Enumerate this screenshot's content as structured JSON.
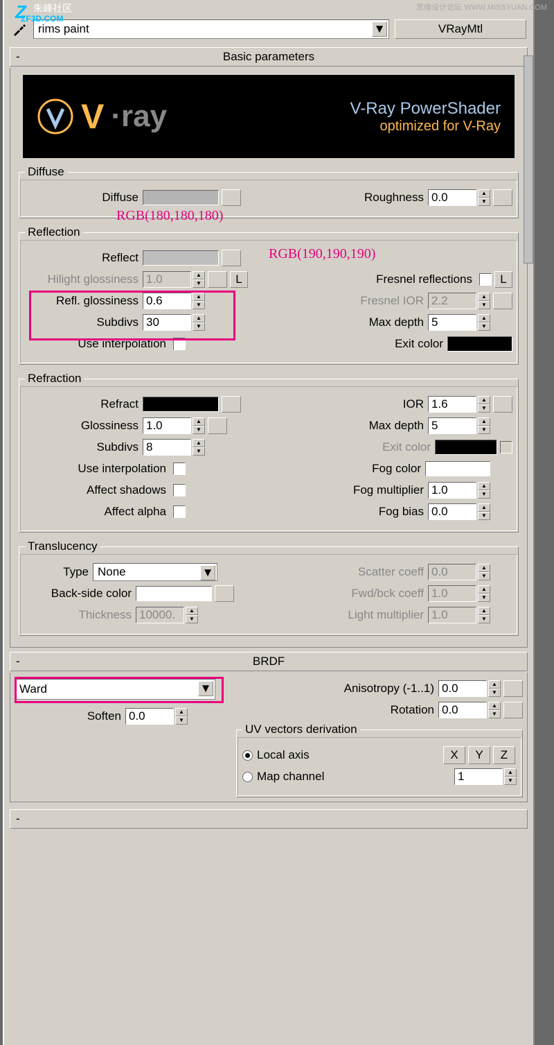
{
  "watermarks": {
    "cn": "朱峰社区",
    "zf": "ZF3D.COM",
    "z": "Z",
    "right": "思缘设计论坛 WWW.MISSYUAN.COM"
  },
  "header": {
    "material_name": "rims paint",
    "type_button": "VRayMtl"
  },
  "rollouts": {
    "basic": "Basic parameters",
    "brdf": "BRDF",
    "minus": "-"
  },
  "banner": {
    "logo_v": "V",
    "logo_text": "·ray",
    "line1": "V-Ray PowerShader",
    "line2": "optimized for V-Ray"
  },
  "groups": {
    "diffuse": "Diffuse",
    "reflection": "Reflection",
    "refraction": "Refraction",
    "translucency": "Translucency",
    "uv": "UV vectors derivation"
  },
  "labels": {
    "diffuse": "Diffuse",
    "roughness": "Roughness",
    "reflect": "Reflect",
    "hilight_gloss": "Hilight glossiness",
    "refl_gloss": "Refl. glossiness",
    "subdivs": "Subdivs",
    "use_interp": "Use interpolation",
    "fresnel_refl": "Fresnel reflections",
    "fresnel_ior": "Fresnel IOR",
    "max_depth": "Max depth",
    "exit_color": "Exit color",
    "refract": "Refract",
    "glossiness": "Glossiness",
    "ior": "IOR",
    "affect_shadows": "Affect shadows",
    "affect_alpha": "Affect alpha",
    "fog_color": "Fog color",
    "fog_mult": "Fog multiplier",
    "fog_bias": "Fog bias",
    "type": "Type",
    "back_side": "Back-side color",
    "thickness": "Thickness",
    "scatter": "Scatter coeff",
    "fwd_bck": "Fwd/bck coeff",
    "light_mult": "Light multiplier",
    "soften": "Soften",
    "anisotropy": "Anisotropy (-1..1)",
    "rotation": "Rotation",
    "local_axis": "Local axis",
    "map_channel": "Map channel",
    "L": "L",
    "X": "X",
    "Y": "Y",
    "Z": "Z"
  },
  "values": {
    "roughness": "0.0",
    "hilight_gloss": "1.0",
    "refl_gloss": "0.6",
    "refl_subdivs": "30",
    "fresnel_ior": "2.2",
    "refl_max_depth": "5",
    "refr_gloss": "1.0",
    "refr_subdivs": "8",
    "ior": "1.6",
    "refr_max_depth": "5",
    "fog_mult": "1.0",
    "fog_bias": "0.0",
    "trans_type": "None",
    "thickness": "10000.",
    "scatter": "0.0",
    "fwd_bck": "1.0",
    "light_mult": "1.0",
    "brdf_type": "Ward",
    "soften": "0.0",
    "anisotropy": "0.0",
    "rotation": "0.0",
    "map_channel": "1"
  },
  "annotations": {
    "rgb1": "RGB(180,180,180)",
    "rgb2": "RGB(190,190,190)"
  }
}
